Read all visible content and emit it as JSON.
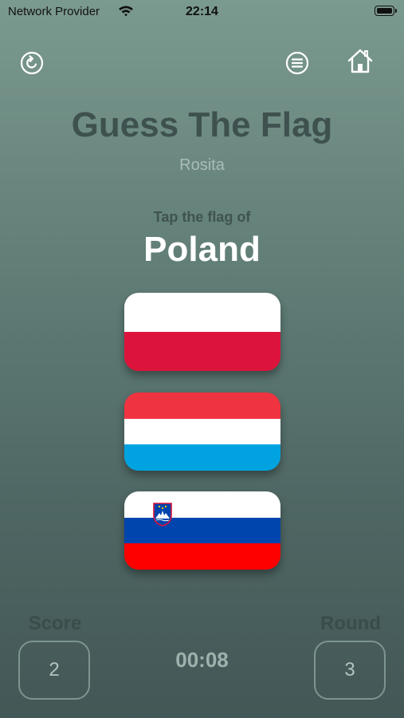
{
  "status_bar": {
    "carrier": "Network Provider",
    "time": "22:14"
  },
  "toolbar": {
    "restart_icon": "restart-icon",
    "menu_icon": "menu-icon",
    "home_icon": "home-icon"
  },
  "header": {
    "title": "Guess The Flag",
    "player": "Rosita"
  },
  "question": {
    "prompt": "Tap the flag of",
    "country": "Poland"
  },
  "flags": [
    {
      "country": "Poland",
      "stripes": [
        "#ffffff",
        "#dc143c"
      ]
    },
    {
      "country": "Luxembourg",
      "stripes": [
        "#ef3340",
        "#ffffff",
        "#00a3e0"
      ]
    },
    {
      "country": "Slovenia",
      "stripes": [
        "#ffffff",
        "#0044ad",
        "#ff0000"
      ]
    }
  ],
  "footer": {
    "score_label": "Score",
    "score_value": "2",
    "round_label": "Round",
    "round_value": "3",
    "timer": "00:08"
  }
}
